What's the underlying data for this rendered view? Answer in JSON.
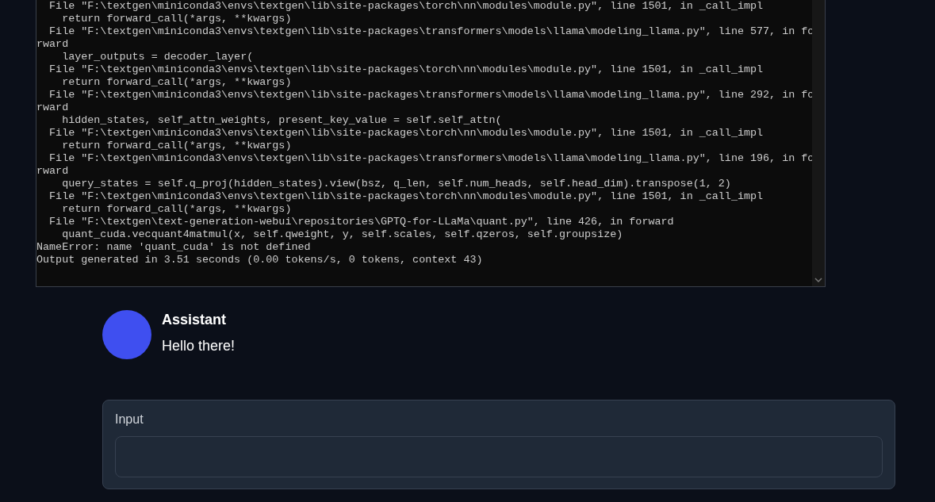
{
  "console": {
    "lines": [
      "  File \"F:\\textgen\\miniconda3\\envs\\textgen\\lib\\site-packages\\torch\\nn\\modules\\module.py\", line 1501, in _call_impl",
      "    return forward_call(*args, **kwargs)",
      "  File \"F:\\textgen\\miniconda3\\envs\\textgen\\lib\\site-packages\\transformers\\models\\llama\\modeling_llama.py\", line 577, in fo",
      "rward",
      "    layer_outputs = decoder_layer(",
      "  File \"F:\\textgen\\miniconda3\\envs\\textgen\\lib\\site-packages\\torch\\nn\\modules\\module.py\", line 1501, in _call_impl",
      "    return forward_call(*args, **kwargs)",
      "  File \"F:\\textgen\\miniconda3\\envs\\textgen\\lib\\site-packages\\transformers\\models\\llama\\modeling_llama.py\", line 292, in fo",
      "rward",
      "    hidden_states, self_attn_weights, present_key_value = self.self_attn(",
      "  File \"F:\\textgen\\miniconda3\\envs\\textgen\\lib\\site-packages\\torch\\nn\\modules\\module.py\", line 1501, in _call_impl",
      "    return forward_call(*args, **kwargs)",
      "  File \"F:\\textgen\\miniconda3\\envs\\textgen\\lib\\site-packages\\transformers\\models\\llama\\modeling_llama.py\", line 196, in fo",
      "rward",
      "    query_states = self.q_proj(hidden_states).view(bsz, q_len, self.num_heads, self.head_dim).transpose(1, 2)",
      "  File \"F:\\textgen\\miniconda3\\envs\\textgen\\lib\\site-packages\\torch\\nn\\modules\\module.py\", line 1501, in _call_impl",
      "    return forward_call(*args, **kwargs)",
      "  File \"F:\\textgen\\text-generation-webui\\repositories\\GPTQ-for-LLaMa\\quant.py\", line 426, in forward",
      "    quant_cuda.vecquant4matmul(x, self.qweight, y, self.scales, self.qzeros, self.groupsize)",
      "NameError: name 'quant_cuda' is not defined",
      "Output generated in 3.51 seconds (0.00 tokens/s, 0 tokens, context 43)"
    ]
  },
  "message": {
    "sender": "Assistant",
    "text": "Hello there!"
  },
  "input": {
    "label": "Input"
  }
}
